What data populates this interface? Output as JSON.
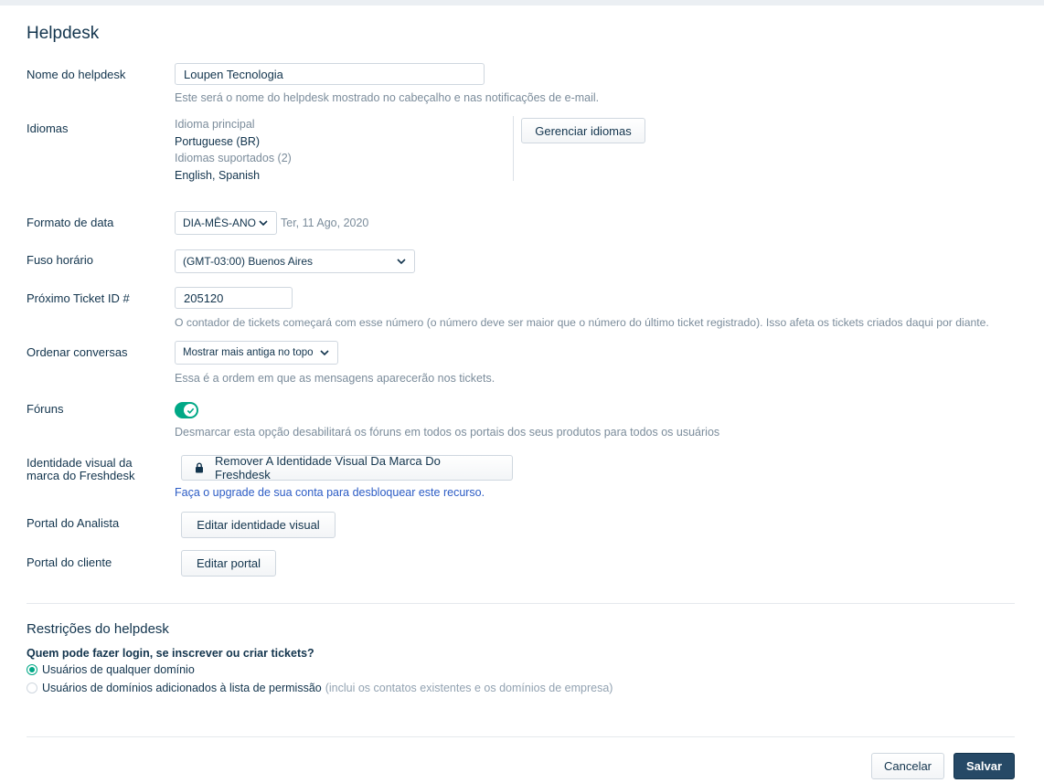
{
  "page": {
    "title": "Helpdesk"
  },
  "helpdesk_name": {
    "label": "Nome do helpdesk",
    "value": "Loupen Tecnologia",
    "hint": "Este será o nome do helpdesk mostrado no cabeçalho e nas notificações de e-mail."
  },
  "languages": {
    "label": "Idiomas",
    "primary_label": "Idioma principal",
    "primary_value": "Portuguese (BR)",
    "supported_label": "Idiomas suportados (2)",
    "supported_value": "English, Spanish",
    "manage_button": "Gerenciar idiomas"
  },
  "date_format": {
    "label": "Formato de data",
    "selected": "DIA-MÊS-ANO",
    "preview": "Ter, 11 Ago, 2020"
  },
  "timezone": {
    "label": "Fuso horário",
    "selected": "(GMT-03:00) Buenos Aires"
  },
  "next_ticket": {
    "label": "Próximo Ticket ID #",
    "value": "205120",
    "hint": "O contador de tickets começará com esse número (o número deve ser maior que o número do último ticket registrado). Isso afeta os tickets criados daqui por diante."
  },
  "conversation_order": {
    "label": "Ordenar conversas",
    "selected": "Mostrar mais antiga no topo",
    "hint": "Essa é a ordem em que as mensagens aparecerão nos tickets."
  },
  "forums": {
    "label": "Fóruns",
    "enabled": true,
    "hint": "Desmarcar esta opção desabilitará os fóruns em todos os portais dos seus produtos para todos os usuários"
  },
  "branding": {
    "label_line1": "Identidade visual da",
    "label_line2": "marca do Freshdesk",
    "button": "Remover A Identidade Visual Da Marca Do Freshdesk",
    "upgrade_link": "Faça o upgrade de sua conta para desbloquear este recurso."
  },
  "agent_portal": {
    "label": "Portal do Analista",
    "button": "Editar identidade visual"
  },
  "customer_portal": {
    "label": "Portal do cliente",
    "button": "Editar portal"
  },
  "restrictions": {
    "title": "Restrições do helpdesk",
    "question": "Quem pode fazer login, se inscrever ou criar tickets?",
    "option_any": "Usuários de qualquer domínio",
    "option_whitelist": "Usuários de domínios adicionados à lista de permissão",
    "option_whitelist_note": "(inclui os contatos existentes e os domínios de empresa)",
    "selected": "any"
  },
  "footer": {
    "cancel": "Cancelar",
    "save": "Salvar"
  },
  "colors": {
    "accent": "#00a886",
    "primary": "#264966",
    "text": "#12344d",
    "muted": "#7b8c9b",
    "link": "#2c5cc5"
  }
}
